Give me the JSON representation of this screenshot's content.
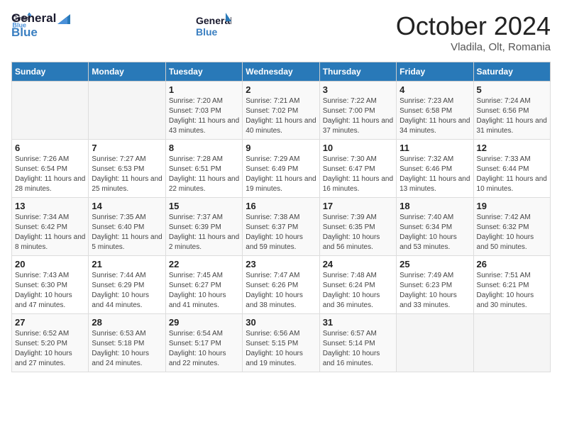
{
  "header": {
    "logo_line1": "General",
    "logo_line2": "Blue",
    "month": "October 2024",
    "location": "Vladila, Olt, Romania"
  },
  "weekdays": [
    "Sunday",
    "Monday",
    "Tuesday",
    "Wednesday",
    "Thursday",
    "Friday",
    "Saturday"
  ],
  "weeks": [
    [
      {
        "day": "",
        "info": ""
      },
      {
        "day": "",
        "info": ""
      },
      {
        "day": "1",
        "info": "Sunrise: 7:20 AM\nSunset: 7:03 PM\nDaylight: 11 hours and 43 minutes."
      },
      {
        "day": "2",
        "info": "Sunrise: 7:21 AM\nSunset: 7:02 PM\nDaylight: 11 hours and 40 minutes."
      },
      {
        "day": "3",
        "info": "Sunrise: 7:22 AM\nSunset: 7:00 PM\nDaylight: 11 hours and 37 minutes."
      },
      {
        "day": "4",
        "info": "Sunrise: 7:23 AM\nSunset: 6:58 PM\nDaylight: 11 hours and 34 minutes."
      },
      {
        "day": "5",
        "info": "Sunrise: 7:24 AM\nSunset: 6:56 PM\nDaylight: 11 hours and 31 minutes."
      }
    ],
    [
      {
        "day": "6",
        "info": "Sunrise: 7:26 AM\nSunset: 6:54 PM\nDaylight: 11 hours and 28 minutes."
      },
      {
        "day": "7",
        "info": "Sunrise: 7:27 AM\nSunset: 6:53 PM\nDaylight: 11 hours and 25 minutes."
      },
      {
        "day": "8",
        "info": "Sunrise: 7:28 AM\nSunset: 6:51 PM\nDaylight: 11 hours and 22 minutes."
      },
      {
        "day": "9",
        "info": "Sunrise: 7:29 AM\nSunset: 6:49 PM\nDaylight: 11 hours and 19 minutes."
      },
      {
        "day": "10",
        "info": "Sunrise: 7:30 AM\nSunset: 6:47 PM\nDaylight: 11 hours and 16 minutes."
      },
      {
        "day": "11",
        "info": "Sunrise: 7:32 AM\nSunset: 6:46 PM\nDaylight: 11 hours and 13 minutes."
      },
      {
        "day": "12",
        "info": "Sunrise: 7:33 AM\nSunset: 6:44 PM\nDaylight: 11 hours and 10 minutes."
      }
    ],
    [
      {
        "day": "13",
        "info": "Sunrise: 7:34 AM\nSunset: 6:42 PM\nDaylight: 11 hours and 8 minutes."
      },
      {
        "day": "14",
        "info": "Sunrise: 7:35 AM\nSunset: 6:40 PM\nDaylight: 11 hours and 5 minutes."
      },
      {
        "day": "15",
        "info": "Sunrise: 7:37 AM\nSunset: 6:39 PM\nDaylight: 11 hours and 2 minutes."
      },
      {
        "day": "16",
        "info": "Sunrise: 7:38 AM\nSunset: 6:37 PM\nDaylight: 10 hours and 59 minutes."
      },
      {
        "day": "17",
        "info": "Sunrise: 7:39 AM\nSunset: 6:35 PM\nDaylight: 10 hours and 56 minutes."
      },
      {
        "day": "18",
        "info": "Sunrise: 7:40 AM\nSunset: 6:34 PM\nDaylight: 10 hours and 53 minutes."
      },
      {
        "day": "19",
        "info": "Sunrise: 7:42 AM\nSunset: 6:32 PM\nDaylight: 10 hours and 50 minutes."
      }
    ],
    [
      {
        "day": "20",
        "info": "Sunrise: 7:43 AM\nSunset: 6:30 PM\nDaylight: 10 hours and 47 minutes."
      },
      {
        "day": "21",
        "info": "Sunrise: 7:44 AM\nSunset: 6:29 PM\nDaylight: 10 hours and 44 minutes."
      },
      {
        "day": "22",
        "info": "Sunrise: 7:45 AM\nSunset: 6:27 PM\nDaylight: 10 hours and 41 minutes."
      },
      {
        "day": "23",
        "info": "Sunrise: 7:47 AM\nSunset: 6:26 PM\nDaylight: 10 hours and 38 minutes."
      },
      {
        "day": "24",
        "info": "Sunrise: 7:48 AM\nSunset: 6:24 PM\nDaylight: 10 hours and 36 minutes."
      },
      {
        "day": "25",
        "info": "Sunrise: 7:49 AM\nSunset: 6:23 PM\nDaylight: 10 hours and 33 minutes."
      },
      {
        "day": "26",
        "info": "Sunrise: 7:51 AM\nSunset: 6:21 PM\nDaylight: 10 hours and 30 minutes."
      }
    ],
    [
      {
        "day": "27",
        "info": "Sunrise: 6:52 AM\nSunset: 5:20 PM\nDaylight: 10 hours and 27 minutes."
      },
      {
        "day": "28",
        "info": "Sunrise: 6:53 AM\nSunset: 5:18 PM\nDaylight: 10 hours and 24 minutes."
      },
      {
        "day": "29",
        "info": "Sunrise: 6:54 AM\nSunset: 5:17 PM\nDaylight: 10 hours and 22 minutes."
      },
      {
        "day": "30",
        "info": "Sunrise: 6:56 AM\nSunset: 5:15 PM\nDaylight: 10 hours and 19 minutes."
      },
      {
        "day": "31",
        "info": "Sunrise: 6:57 AM\nSunset: 5:14 PM\nDaylight: 10 hours and 16 minutes."
      },
      {
        "day": "",
        "info": ""
      },
      {
        "day": "",
        "info": ""
      }
    ]
  ]
}
